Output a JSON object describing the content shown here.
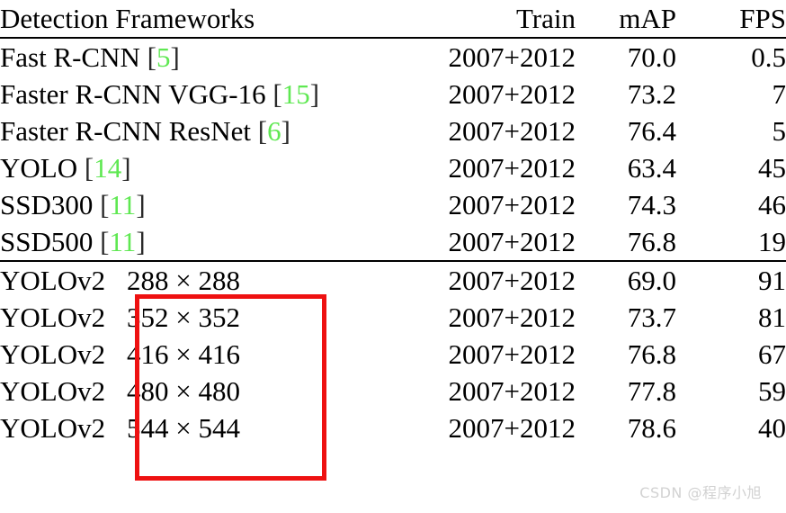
{
  "table": {
    "headers": {
      "name": "Detection Frameworks",
      "train": "Train",
      "map": "mAP",
      "fps": "FPS"
    },
    "rows": [
      {
        "name": "Fast R-CNN",
        "cite": "5",
        "train": "2007+2012",
        "map": "70.0",
        "fps": "0.5"
      },
      {
        "name": "Faster R-CNN VGG-16",
        "cite": "15",
        "train": "2007+2012",
        "map": "73.2",
        "fps": "7"
      },
      {
        "name": "Faster R-CNN ResNet",
        "cite": "6",
        "train": "2007+2012",
        "map": "76.4",
        "fps": "5"
      },
      {
        "name": "YOLO",
        "cite": "14",
        "train": "2007+2012",
        "map": "63.4",
        "fps": "45"
      },
      {
        "name": "SSD300",
        "cite": "11",
        "train": "2007+2012",
        "map": "74.3",
        "fps": "46"
      },
      {
        "name": "SSD500",
        "cite": "11",
        "train": "2007+2012",
        "map": "76.8",
        "fps": "19"
      }
    ],
    "yolov2_rows": [
      {
        "name": "YOLOv2",
        "resolution": "288 × 288",
        "train": "2007+2012",
        "map": "69.0",
        "fps": "91",
        "map_bold": false
      },
      {
        "name": "YOLOv2",
        "resolution": "352 × 352",
        "train": "2007+2012",
        "map": "73.7",
        "fps": "81",
        "map_bold": false
      },
      {
        "name": "YOLOv2",
        "resolution": "416 × 416",
        "train": "2007+2012",
        "map": "76.8",
        "fps": "67",
        "map_bold": false
      },
      {
        "name": "YOLOv2",
        "resolution": "480 × 480",
        "train": "2007+2012",
        "map": "77.8",
        "fps": "59",
        "map_bold": false
      },
      {
        "name": "YOLOv2",
        "resolution": "544 × 544",
        "train": "2007+2012",
        "map": "78.6",
        "fps": "40",
        "map_bold": true
      }
    ]
  },
  "annotation": {
    "red_box_color": "#ee1111"
  },
  "watermark": {
    "text": "CSDN @程序小旭",
    "color": "#d2d2d2"
  },
  "citation_color": "#5fe852"
}
